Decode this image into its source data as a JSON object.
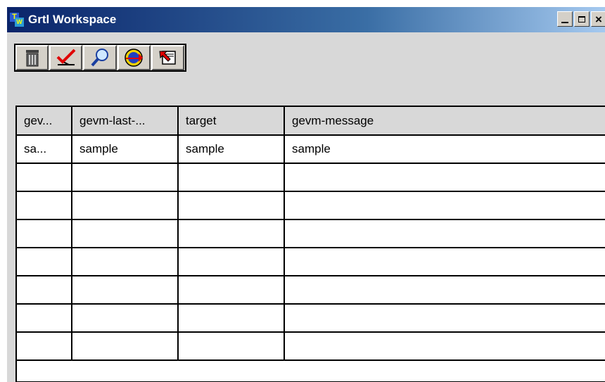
{
  "window": {
    "title": "Grtl Workspace",
    "controls": {
      "minimize": "_",
      "close": "✕"
    }
  },
  "toolbar": {
    "buttons": [
      {
        "name": "delete",
        "icon": "trash-icon"
      },
      {
        "name": "check-edit",
        "icon": "checkmark-icon"
      },
      {
        "name": "search",
        "icon": "magnifier-icon"
      },
      {
        "name": "refresh",
        "icon": "circle-arrow-icon"
      },
      {
        "name": "exit",
        "icon": "exit-arrow-icon"
      }
    ]
  },
  "table": {
    "columns": [
      "gev...",
      "gevm-last-...",
      "target",
      "gevm-message"
    ],
    "rows": [
      [
        "sa...",
        "sample",
        "sample",
        "sample"
      ],
      [
        "",
        "",
        "",
        ""
      ],
      [
        "",
        "",
        "",
        ""
      ],
      [
        "",
        "",
        "",
        ""
      ],
      [
        "",
        "",
        "",
        ""
      ],
      [
        "",
        "",
        "",
        ""
      ],
      [
        "",
        "",
        "",
        ""
      ],
      [
        "",
        "",
        "",
        ""
      ]
    ]
  },
  "colors": {
    "titlebar_start": "#0a246a",
    "titlebar_end": "#a6caf0",
    "window_bg": "#d8d8d8"
  }
}
